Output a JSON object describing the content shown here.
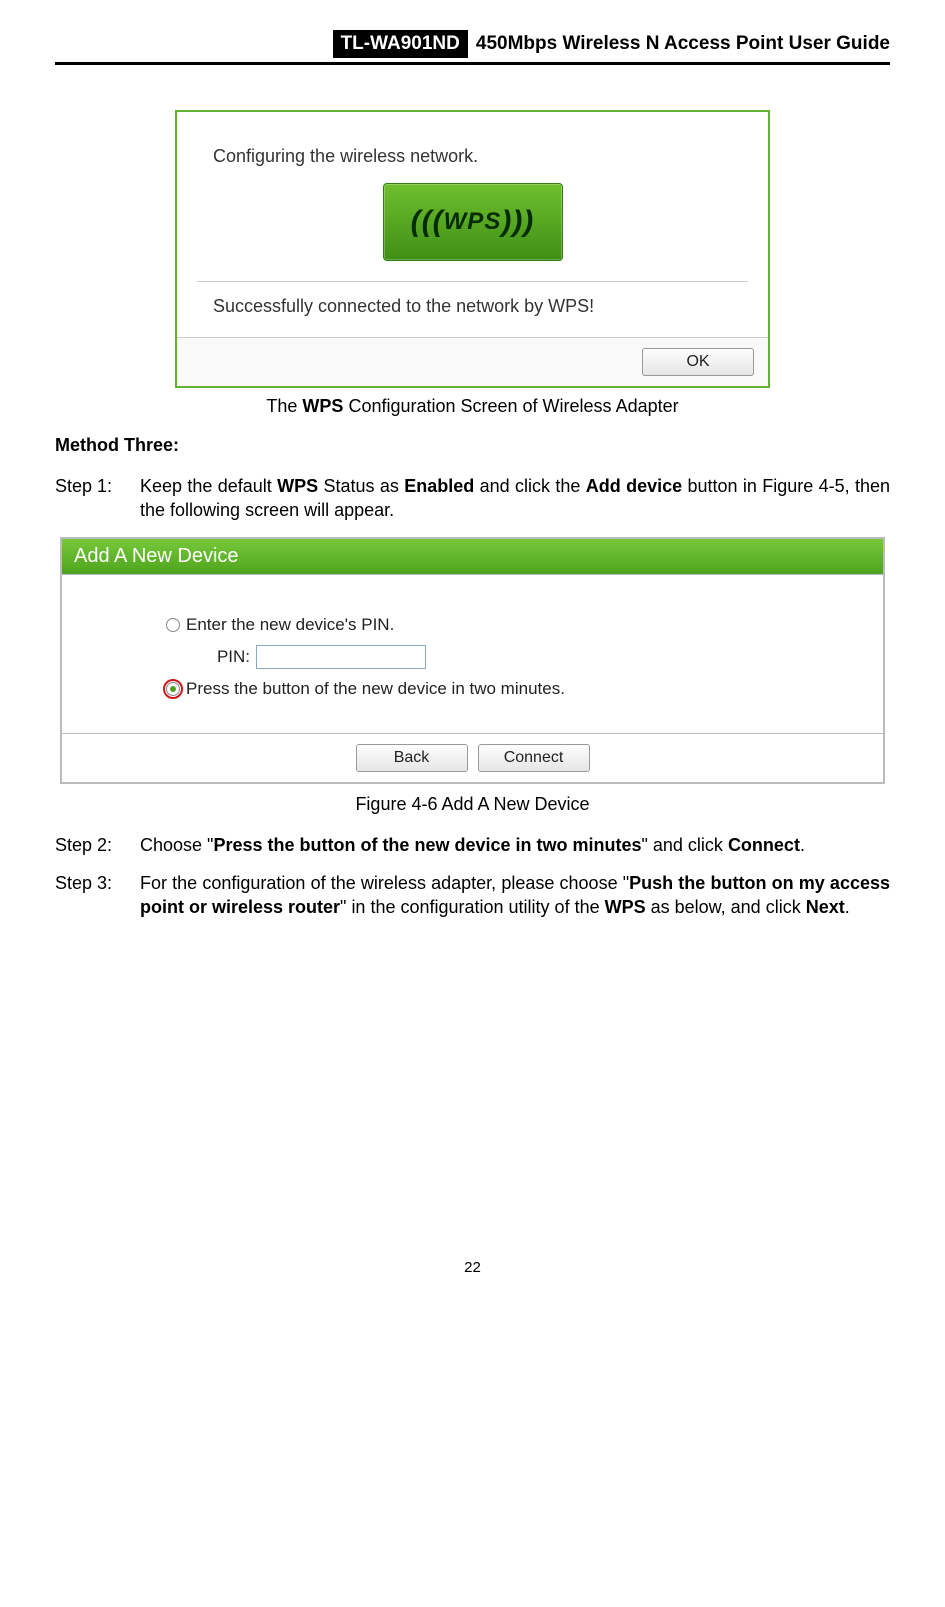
{
  "header": {
    "model": "TL-WA901ND",
    "title": "450Mbps Wireless N Access Point User Guide"
  },
  "wps_dialog": {
    "configuring_text": "Configuring the wireless network.",
    "logo_text": "WPS",
    "success_text": "Successfully connected to the network by WPS!",
    "ok_label": "OK"
  },
  "caption1_pre": "The ",
  "caption1_bold": "WPS",
  "caption1_post": " Configuration Screen of Wireless Adapter",
  "method_heading": "Method Three:",
  "step1": {
    "label": "Step 1:",
    "t1": "Keep the default ",
    "b1": "WPS",
    "t2": " Status as ",
    "b2": "Enabled",
    "t3": " and click the ",
    "b3": "Add device",
    "t4": " button in Figure 4-5, then the following screen will appear."
  },
  "add_panel": {
    "title": "Add A New Device",
    "opt1": "Enter the new device's PIN.",
    "pin_label": "PIN:",
    "pin_value": "",
    "opt2": "Press the button of the new device in two minutes.",
    "back_label": "Back",
    "connect_label": "Connect"
  },
  "figure_caption": "Figure 4-6    Add A New Device",
  "step2": {
    "label": "Step 2:",
    "t1": "Choose \"",
    "b1": "Press the button of the new device in two minutes",
    "t2": "\" and click ",
    "b2": "Connect",
    "t3": "."
  },
  "step3": {
    "label": "Step 3:",
    "t1": "For the configuration of the wireless adapter, please choose \"",
    "b1": "Push the button on my access point or wireless router",
    "t2": "\" in the configuration utility of the ",
    "b2": "WPS",
    "t3": " as below, and click ",
    "b3": "Next",
    "t4": "."
  },
  "page_number": "22"
}
